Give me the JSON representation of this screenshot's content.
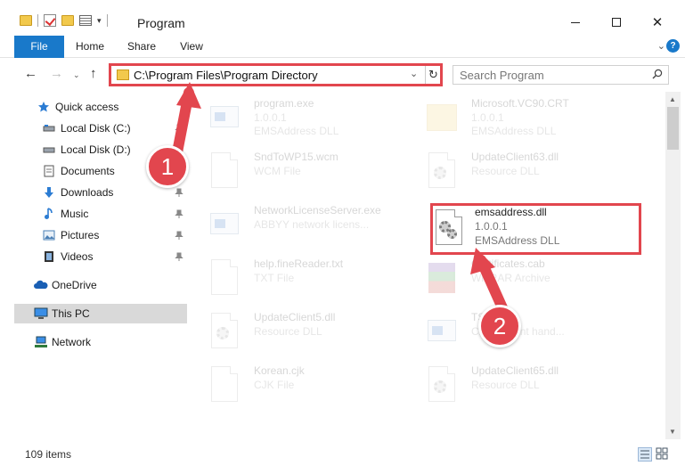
{
  "window": {
    "title": "Program",
    "minimize_icon": "minimize-icon",
    "maximize_icon": "maximize-icon",
    "close_glyph": "✕"
  },
  "ribbon": {
    "tabs": [
      {
        "label": "File",
        "active": true
      },
      {
        "label": "Home"
      },
      {
        "label": "Share"
      },
      {
        "label": "View"
      }
    ],
    "expand_glyph": "⌄",
    "help_glyph": "?"
  },
  "navigation": {
    "back_glyph": "←",
    "forward_glyph": "→",
    "recent_glyph": "⌄",
    "up_glyph": "↑",
    "address": "C:\\Program Files\\Program Directory",
    "dropdown_glyph": "⌄",
    "refresh_glyph": "↻",
    "search_placeholder": "Search Program"
  },
  "sidebar": {
    "items": [
      {
        "label": "Quick access",
        "icon": "star-icon"
      },
      {
        "label": "Local Disk (C:)",
        "icon": "drive-icon",
        "pinned": true
      },
      {
        "label": "Local Disk (D:)",
        "icon": "drive-icon",
        "pinned": true
      },
      {
        "label": "Documents",
        "icon": "documents-icon",
        "pinned": true
      },
      {
        "label": "Downloads",
        "icon": "download-icon",
        "pinned": true
      },
      {
        "label": "Music",
        "icon": "music-icon",
        "pinned": true
      },
      {
        "label": "Pictures",
        "icon": "pictures-icon",
        "pinned": true
      },
      {
        "label": "Videos",
        "icon": "videos-icon",
        "pinned": true
      },
      {
        "label": "OneDrive",
        "icon": "cloud-icon"
      },
      {
        "label": "This PC",
        "icon": "computer-icon",
        "selected": true
      },
      {
        "label": "Network",
        "icon": "network-icon"
      }
    ]
  },
  "files": [
    {
      "name": "program.exe",
      "line2": "1.0.0.1",
      "line3": "EMSAddress DLL",
      "icon": "exe-icon",
      "faded": true
    },
    {
      "name": "Microsoft.VC90.CRT",
      "line2": "1.0.0.1",
      "line3": "EMSAddress DLL",
      "icon": "folder-icon",
      "faded": true
    },
    {
      "name": "SndToWP15.wcm",
      "line2": "WCM File",
      "line3": "",
      "icon": "document-icon",
      "faded": true
    },
    {
      "name": "UpdateClient63.dll",
      "line2": "Resource DLL",
      "line3": "",
      "icon": "dll-icon",
      "faded": true
    },
    {
      "name": "NetworkLicenseServer.exe",
      "line2": "ABBYY network licens...",
      "line3": "",
      "icon": "exe-icon",
      "faded": true
    },
    {
      "name": "emsaddress.dll",
      "line2": "1.0.0.1",
      "line3": "EMSAddress DLL",
      "icon": "dll-icon",
      "faded": false,
      "highlighted": true
    },
    {
      "name": "help.fineReader.txt",
      "line2": "TXT File",
      "line3": "",
      "icon": "document-icon",
      "faded": true
    },
    {
      "name": "Certificates.cab",
      "line2": "WinRAR Archive",
      "line3": "",
      "icon": "archive-icon",
      "faded": true
    },
    {
      "name": "UpdateClient5.dll",
      "line2": "Resource DLL",
      "line3": "",
      "icon": "dll-icon",
      "faded": true
    },
    {
      "name": "TSTI.exe",
      "line2": "Crash event hand...",
      "line3": "",
      "icon": "exe-icon",
      "faded": true
    },
    {
      "name": "Korean.cjk",
      "line2": "CJK File",
      "line3": "",
      "icon": "document-icon",
      "faded": true
    },
    {
      "name": "UpdateClient65.dll",
      "line2": "Resource DLL",
      "line3": "",
      "icon": "dll-icon",
      "faded": true
    }
  ],
  "status": {
    "item_count": "109 items"
  },
  "annotations": {
    "step1": "1",
    "step2": "2"
  },
  "colors": {
    "accent": "#1979ca",
    "highlight": "#e2464e",
    "selected_bg": "#d9d9d9"
  }
}
